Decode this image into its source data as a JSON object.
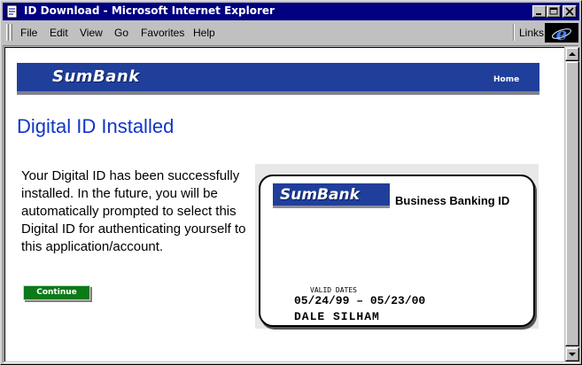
{
  "window": {
    "title": "ID Download - Microsoft Internet Explorer"
  },
  "menubar": {
    "items": [
      {
        "label": "File"
      },
      {
        "label": "Edit"
      },
      {
        "label": "View"
      },
      {
        "label": "Go"
      },
      {
        "label": "Favorites"
      },
      {
        "label": "Help"
      }
    ],
    "links_label": "Links"
  },
  "page": {
    "brand": "SumBank",
    "nav_home": "Home",
    "title": "Digital ID Installed",
    "message": "Your Digital ID has been successfully installed. In the future, you will be automatically prompted to select this Digital ID for authenticating yourself to this application/account.",
    "continue_label": "Continue"
  },
  "card": {
    "brand": "SumBank",
    "type": "Business Banking ID",
    "valid_label": "VALID DATES",
    "valid_dates": "05/24/99 – 05/23/00",
    "holder": "DALE SILHAM"
  },
  "colors": {
    "titlebar": "#000080",
    "banner": "#1f3f9a",
    "title_text": "#1036c8",
    "continue_button": "#0d7a1a"
  }
}
